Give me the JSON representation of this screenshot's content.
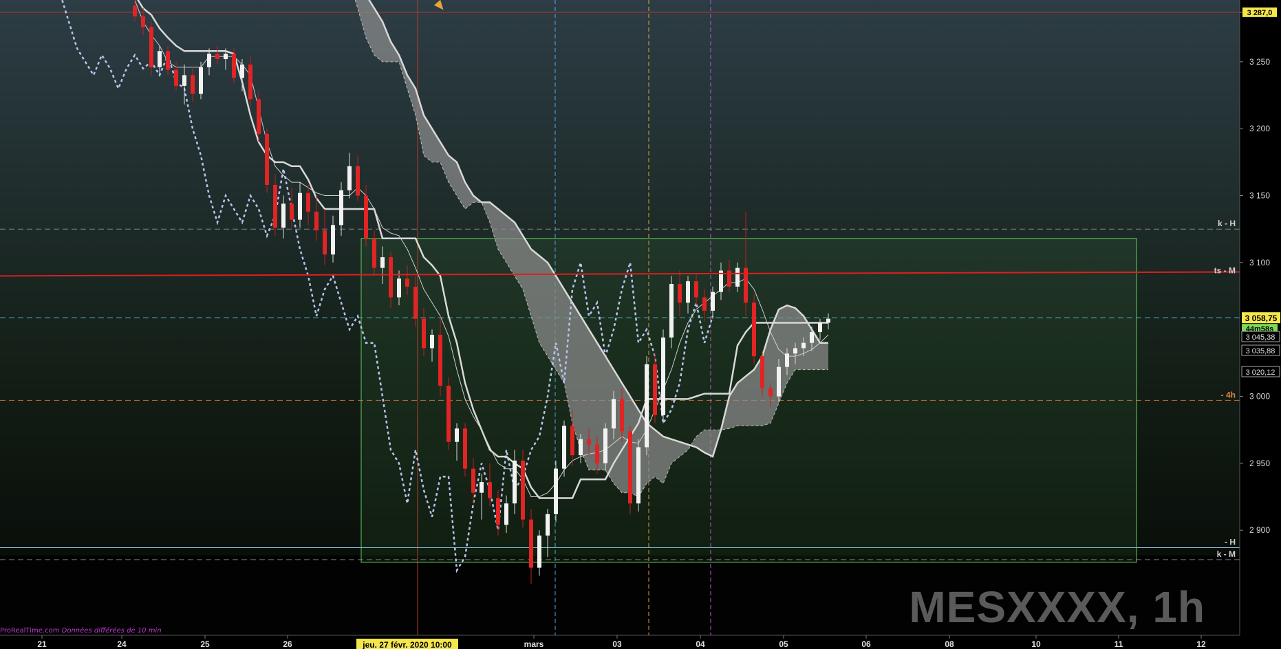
{
  "instrument": {
    "symbol_label": "MESXXXX, 1h"
  },
  "credit": {
    "source": "ProRealTime.com",
    "note": "Données différées de 10 min"
  },
  "colors": {
    "background_top": "#2a3b43",
    "background_mid": "#1b2a20",
    "background_bottom": "#050505",
    "bull_candle": "#f2f2f2",
    "bear_candle": "#e22424",
    "cloud_fill": "#8c8c8c",
    "range_box": "#5fcf5f",
    "main_level": "#e01e1e",
    "price_badge": "#f5e64a",
    "timer_badge": "#7ed957",
    "chikou": "#b8c4ee"
  },
  "price_axis": {
    "tick_labels": [
      "3 287,0",
      "3 250",
      "3 200",
      "3 150",
      "3 100",
      "3 000",
      "2 950",
      "2 900"
    ],
    "current_price": "3 058,75",
    "timer": "44m58s",
    "level_labels": [
      "3 045,38",
      "3 035,88",
      "3 020,12"
    ]
  },
  "level_tags": [
    {
      "label": "k - H",
      "price": 3125
    },
    {
      "label": "ts - M",
      "price": 3090
    },
    {
      "label": "- 4h",
      "price": 2997
    },
    {
      "label": "- H",
      "price": 2887
    },
    {
      "label": "k - M",
      "price": 2878
    }
  ],
  "time_axis": {
    "labels": [
      "21",
      "24",
      "25",
      "26",
      "mars",
      "03",
      "04",
      "05",
      "06",
      "08",
      "10",
      "11",
      "12"
    ],
    "cursor_label": "jeu. 27 févr. 2020 10:00"
  },
  "chart_data": {
    "type": "candlestick",
    "timeframe": "1h",
    "ylim": [
      2840,
      3290
    ],
    "candles": [
      [
        3292,
        3296,
        3280,
        3284
      ],
      [
        3284,
        3290,
        3270,
        3276
      ],
      [
        3276,
        3280,
        3240,
        3246
      ],
      [
        3246,
        3262,
        3240,
        3258
      ],
      [
        3258,
        3262,
        3240,
        3244
      ],
      [
        3244,
        3250,
        3228,
        3232
      ],
      [
        3232,
        3248,
        3218,
        3240
      ],
      [
        3240,
        3246,
        3220,
        3226
      ],
      [
        3226,
        3250,
        3222,
        3246
      ],
      [
        3246,
        3260,
        3240,
        3256
      ],
      [
        3256,
        3262,
        3248,
        3252
      ],
      [
        3252,
        3260,
        3244,
        3256
      ],
      [
        3256,
        3260,
        3234,
        3238
      ],
      [
        3238,
        3252,
        3228,
        3248
      ],
      [
        3248,
        3254,
        3216,
        3222
      ],
      [
        3222,
        3228,
        3190,
        3196
      ],
      [
        3196,
        3200,
        3152,
        3158
      ],
      [
        3158,
        3166,
        3120,
        3126
      ],
      [
        3126,
        3150,
        3118,
        3144
      ],
      [
        3144,
        3156,
        3126,
        3132
      ],
      [
        3132,
        3160,
        3126,
        3152
      ],
      [
        3152,
        3158,
        3128,
        3138
      ],
      [
        3138,
        3150,
        3116,
        3124
      ],
      [
        3124,
        3140,
        3098,
        3106
      ],
      [
        3106,
        3135,
        3100,
        3128
      ],
      [
        3128,
        3160,
        3120,
        3154
      ],
      [
        3154,
        3182,
        3148,
        3172
      ],
      [
        3172,
        3180,
        3146,
        3150
      ],
      [
        3150,
        3158,
        3112,
        3118
      ],
      [
        3118,
        3124,
        3090,
        3096
      ],
      [
        3096,
        3112,
        3084,
        3104
      ],
      [
        3104,
        3108,
        3066,
        3074
      ],
      [
        3074,
        3094,
        3068,
        3088
      ],
      [
        3088,
        3098,
        3076,
        3082
      ],
      [
        3082,
        3090,
        3052,
        3058
      ],
      [
        3058,
        3066,
        3030,
        3036
      ],
      [
        3036,
        3050,
        3026,
        3046
      ],
      [
        3046,
        3060,
        3000,
        3008
      ],
      [
        3008,
        3014,
        2960,
        2966
      ],
      [
        2966,
        2980,
        2952,
        2976
      ],
      [
        2976,
        2980,
        2940,
        2946
      ],
      [
        2946,
        2954,
        2920,
        2928
      ],
      [
        2928,
        2942,
        2908,
        2936
      ],
      [
        2936,
        2950,
        2918,
        2924
      ],
      [
        2924,
        2930,
        2896,
        2904
      ],
      [
        2904,
        2926,
        2898,
        2920
      ],
      [
        2920,
        2960,
        2912,
        2952
      ],
      [
        2952,
        2960,
        2902,
        2908
      ],
      [
        2908,
        2916,
        2860,
        2872
      ],
      [
        2872,
        2900,
        2866,
        2896
      ],
      [
        2896,
        2916,
        2880,
        2912
      ],
      [
        2912,
        2952,
        2906,
        2946
      ],
      [
        2946,
        2982,
        2940,
        2978
      ],
      [
        2978,
        2990,
        2948,
        2956
      ],
      [
        2956,
        2972,
        2950,
        2968
      ],
      [
        2968,
        2976,
        2956,
        2964
      ],
      [
        2964,
        2970,
        2942,
        2950
      ],
      [
        2950,
        2980,
        2944,
        2976
      ],
      [
        2976,
        3004,
        2968,
        2998
      ],
      [
        2998,
        3006,
        2966,
        2974
      ],
      [
        2974,
        2978,
        2912,
        2920
      ],
      [
        2920,
        2968,
        2914,
        2962
      ],
      [
        2962,
        3030,
        2956,
        3024
      ],
      [
        3024,
        3032,
        2980,
        2986
      ],
      [
        2986,
        3050,
        2980,
        3044
      ],
      [
        3044,
        3090,
        3036,
        3084
      ],
      [
        3084,
        3094,
        3060,
        3070
      ],
      [
        3070,
        3090,
        3062,
        3086
      ],
      [
        3086,
        3092,
        3068,
        3074
      ],
      [
        3074,
        3080,
        3056,
        3064
      ],
      [
        3064,
        3082,
        3058,
        3078
      ],
      [
        3078,
        3100,
        3072,
        3094
      ],
      [
        3094,
        3102,
        3078,
        3082
      ],
      [
        3082,
        3100,
        3078,
        3096
      ],
      [
        3096,
        3138,
        3060,
        3070
      ],
      [
        3070,
        3076,
        3024,
        3030
      ],
      [
        3030,
        3034,
        3000,
        3006
      ],
      [
        3006,
        3010,
        2992,
        3000
      ],
      [
        3000,
        3028,
        2996,
        3022
      ],
      [
        3022,
        3036,
        3016,
        3032
      ],
      [
        3032,
        3040,
        3024,
        3036
      ],
      [
        3036,
        3044,
        3030,
        3040
      ],
      [
        3040,
        3052,
        3034,
        3048
      ],
      [
        3048,
        3058,
        3042,
        3055
      ],
      [
        3055,
        3062,
        3050,
        3058
      ]
    ],
    "tenkan": [
      3296,
      3280,
      3270,
      3262,
      3250,
      3246,
      3246,
      3246,
      3246,
      3254,
      3254,
      3254,
      3254,
      3248,
      3240,
      3215,
      3190,
      3172,
      3165,
      3160,
      3160,
      3156,
      3152,
      3150,
      3150,
      3150,
      3150,
      3156,
      3150,
      3140,
      3126,
      3122,
      3120,
      3110,
      3096,
      3080,
      3070,
      3060,
      3045,
      3020,
      2998,
      2985,
      2975,
      2962,
      2950,
      2946,
      2946,
      2938,
      2925,
      2925,
      2928,
      2935,
      2945,
      2952,
      2955,
      2957,
      2958,
      2960,
      2965,
      2970,
      2966,
      2965,
      2975,
      2990,
      3005,
      3020,
      3040,
      3055,
      3065,
      3070,
      3075,
      3080,
      3085,
      3085,
      3088,
      3080,
      3065,
      3048,
      3035,
      3030,
      3030,
      3032,
      3035,
      3040,
      3046
    ],
    "kijun": [
      3300,
      3290,
      3285,
      3275,
      3268,
      3262,
      3258,
      3258,
      3258,
      3258,
      3258,
      3258,
      3256,
      3235,
      3210,
      3190,
      3180,
      3175,
      3175,
      3172,
      3172,
      3162,
      3148,
      3140,
      3140,
      3140,
      3140,
      3140,
      3140,
      3140,
      3118,
      3118,
      3118,
      3118,
      3118,
      3104,
      3098,
      3090,
      3060,
      3040,
      3010,
      2990,
      2975,
      2960,
      2955,
      2955,
      2950,
      2946,
      2932,
      2924,
      2924,
      2924,
      2924,
      2924,
      2938,
      2938,
      2938,
      2938,
      2950,
      2960,
      2970,
      2980,
      2998,
      2998,
      2998,
      2998,
      2998,
      2998,
      3000,
      3002,
      3002,
      3002,
      3002,
      3038,
      3048,
      3055,
      3055,
      3055,
      3055,
      3055,
      3055,
      3055,
      3055,
      3055,
      3055
    ],
    "chikou": [
      3300,
      3280,
      3260,
      3250,
      3240,
      3255,
      3245,
      3230,
      3245,
      3255,
      3245,
      3250,
      3240,
      3255,
      3235,
      3230,
      3200,
      3180,
      3150,
      3130,
      3150,
      3140,
      3130,
      3150,
      3140,
      3120,
      3135,
      3170,
      3140,
      3110,
      3090,
      3060,
      3080,
      3090,
      3070,
      3050,
      3060,
      3040,
      3040,
      3000,
      2960,
      2950,
      2920,
      2960,
      2930,
      2910,
      2940,
      2940,
      2870,
      2880,
      2920,
      2950,
      2930,
      2900,
      2960,
      2930,
      2940,
      2960,
      2970,
      3000,
      3040,
      3010,
      3080,
      3100,
      3060,
      3070,
      3030,
      3050,
      3080,
      3100,
      3040,
      3050,
      3030,
      2980,
      2990,
      3010,
      3050,
      3070,
      3040,
      3060
    ],
    "cloud_a": [
      3310,
      3305,
      3300,
      3290,
      3280,
      3265,
      3255,
      3240,
      3230,
      3210,
      3200,
      3190,
      3180,
      3175,
      3160,
      3150,
      3145,
      3145,
      3140,
      3135,
      3130,
      3120,
      3110,
      3105,
      3100,
      3090,
      3080,
      3070,
      3060,
      3050,
      3040,
      3030,
      3020,
      3010,
      3000,
      2990,
      2980,
      2975,
      2970,
      2968,
      2966,
      2964,
      2962,
      2958,
      2955,
      2975,
      3000,
      3010,
      3015,
      3020,
      3030,
      3050,
      3065,
      3068,
      3066,
      3060,
      3050,
      3040,
      3040
    ],
    "cloud_b": [
      3310,
      3290,
      3268,
      3255,
      3250,
      3250,
      3250,
      3230,
      3210,
      3180,
      3175,
      3175,
      3160,
      3150,
      3140,
      3145,
      3145,
      3130,
      3110,
      3100,
      3090,
      3080,
      3060,
      3040,
      3030,
      3020,
      3010,
      2980,
      2960,
      2945,
      2945,
      2945,
      2935,
      2928,
      2928,
      2925,
      2935,
      2940,
      2935,
      2950,
      2955,
      2960,
      2970,
      2975,
      2975,
      2975,
      2976,
      2978,
      2978,
      2978,
      2978,
      2980,
      2995,
      3010,
      3020,
      3020,
      3020,
      3020,
      3020
    ]
  }
}
